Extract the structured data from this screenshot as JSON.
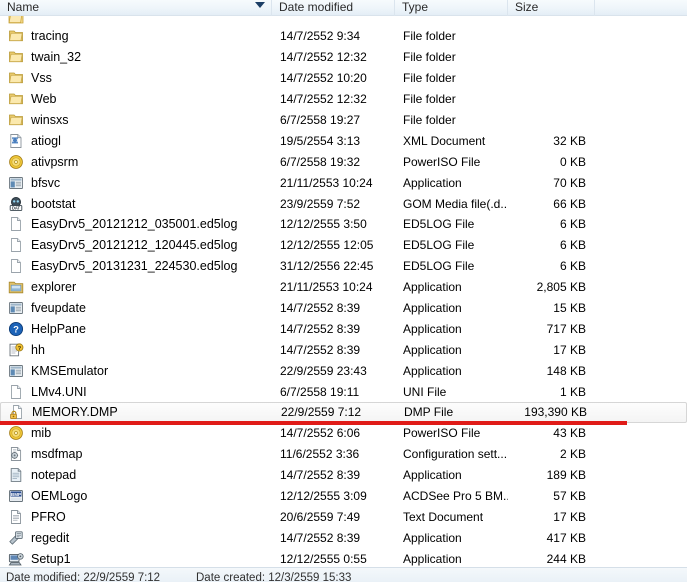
{
  "window": {
    "type": "file-explorer-details-view"
  },
  "columns": {
    "name": "Name",
    "date_modified": "Date modified",
    "type": "Type",
    "size": "Size",
    "sort_column": "Name",
    "sort_direction": "descending",
    "sort_icon": "chevron-down-icon"
  },
  "annotation": {
    "color": "#e01b18",
    "shape": "horizontal-line",
    "target_row": "MEMORY.DMP"
  },
  "selection": {
    "selected_file": "MEMORY.DMP"
  },
  "files": [
    {
      "name": "tracing",
      "date": "14/7/2552 9:34",
      "type": "File folder",
      "size": "",
      "icon": "folder-icon",
      "selected": false
    },
    {
      "name": "twain_32",
      "date": "14/7/2552 12:32",
      "type": "File folder",
      "size": "",
      "icon": "folder-icon",
      "selected": false
    },
    {
      "name": "Vss",
      "date": "14/7/2552 10:20",
      "type": "File folder",
      "size": "",
      "icon": "folder-icon",
      "selected": false
    },
    {
      "name": "Web",
      "date": "14/7/2552 12:32",
      "type": "File folder",
      "size": "",
      "icon": "folder-icon",
      "selected": false
    },
    {
      "name": "winsxs",
      "date": "6/7/2558 19:27",
      "type": "File folder",
      "size": "",
      "icon": "folder-icon",
      "selected": false
    },
    {
      "name": "atiogl",
      "date": "19/5/2554 3:13",
      "type": "XML Document",
      "size": "32 KB",
      "icon": "xml-document-icon",
      "selected": false
    },
    {
      "name": "ativpsrm",
      "date": "6/7/2558 19:32",
      "type": "PowerISO File",
      "size": "0 KB",
      "icon": "disc-icon",
      "selected": false
    },
    {
      "name": "bfsvc",
      "date": "21/11/2553 10:24",
      "type": "Application",
      "size": "70 KB",
      "icon": "application-icon",
      "selected": false
    },
    {
      "name": "bootstat",
      "date": "23/9/2559 7:52",
      "type": "GOM Media file(.d...",
      "size": "66 KB",
      "icon": "dat-file-icon",
      "selected": false
    },
    {
      "name": "EasyDrv5_20121212_035001.ed5log",
      "date": "12/12/2555 3:50",
      "type": "ED5LOG File",
      "size": "6 KB",
      "icon": "blank-file-icon",
      "selected": false
    },
    {
      "name": "EasyDrv5_20121212_120445.ed5log",
      "date": "12/12/2555 12:05",
      "type": "ED5LOG File",
      "size": "6 KB",
      "icon": "blank-file-icon",
      "selected": false
    },
    {
      "name": "EasyDrv5_20131231_224530.ed5log",
      "date": "31/12/2556 22:45",
      "type": "ED5LOG File",
      "size": "6 KB",
      "icon": "blank-file-icon",
      "selected": false
    },
    {
      "name": "explorer",
      "date": "21/11/2553 10:24",
      "type": "Application",
      "size": "2,805 KB",
      "icon": "explorer-icon",
      "selected": false
    },
    {
      "name": "fveupdate",
      "date": "14/7/2552 8:39",
      "type": "Application",
      "size": "15 KB",
      "icon": "application-icon",
      "selected": false
    },
    {
      "name": "HelpPane",
      "date": "14/7/2552 8:39",
      "type": "Application",
      "size": "717 KB",
      "icon": "help-icon",
      "selected": false
    },
    {
      "name": "hh",
      "date": "14/7/2552 8:39",
      "type": "Application",
      "size": "17 KB",
      "icon": "hh-help-icon",
      "selected": false
    },
    {
      "name": "KMSEmulator",
      "date": "22/9/2559 23:43",
      "type": "Application",
      "size": "148 KB",
      "icon": "application-icon",
      "selected": false
    },
    {
      "name": "LMv4.UNI",
      "date": "6/7/2558 19:11",
      "type": "UNI File",
      "size": "1 KB",
      "icon": "blank-file-icon",
      "selected": false
    },
    {
      "name": "MEMORY.DMP",
      "date": "22/9/2559 7:12",
      "type": "DMP File",
      "size": "193,390 KB",
      "icon": "locked-file-icon",
      "selected": true
    },
    {
      "name": "mib",
      "date": "14/7/2552 6:06",
      "type": "PowerISO File",
      "size": "43 KB",
      "icon": "disc-icon",
      "selected": false
    },
    {
      "name": "msdfmap",
      "date": "11/6/2552 3:36",
      "type": "Configuration sett...",
      "size": "2 KB",
      "icon": "config-file-icon",
      "selected": false
    },
    {
      "name": "notepad",
      "date": "14/7/2552 8:39",
      "type": "Application",
      "size": "189 KB",
      "icon": "notepad-icon",
      "selected": false
    },
    {
      "name": "OEMLogo",
      "date": "12/12/2555 3:09",
      "type": "ACDSee Pro 5 BM...",
      "size": "57 KB",
      "icon": "bmp-image-icon",
      "selected": false
    },
    {
      "name": "PFRO",
      "date": "20/6/2559 7:49",
      "type": "Text Document",
      "size": "17 KB",
      "icon": "text-document-icon",
      "selected": false
    },
    {
      "name": "regedit",
      "date": "14/7/2552 8:39",
      "type": "Application",
      "size": "417 KB",
      "icon": "regedit-icon",
      "selected": false
    },
    {
      "name": "Setup1",
      "date": "12/12/2555 0:55",
      "type": "Application",
      "size": "244 KB",
      "icon": "setup-icon",
      "selected": false
    }
  ],
  "status_bar": {
    "date_modified_label": "Date modified: 22/9/2559 7:12",
    "date_created_label": "Date created: 12/3/2559 15:33"
  }
}
